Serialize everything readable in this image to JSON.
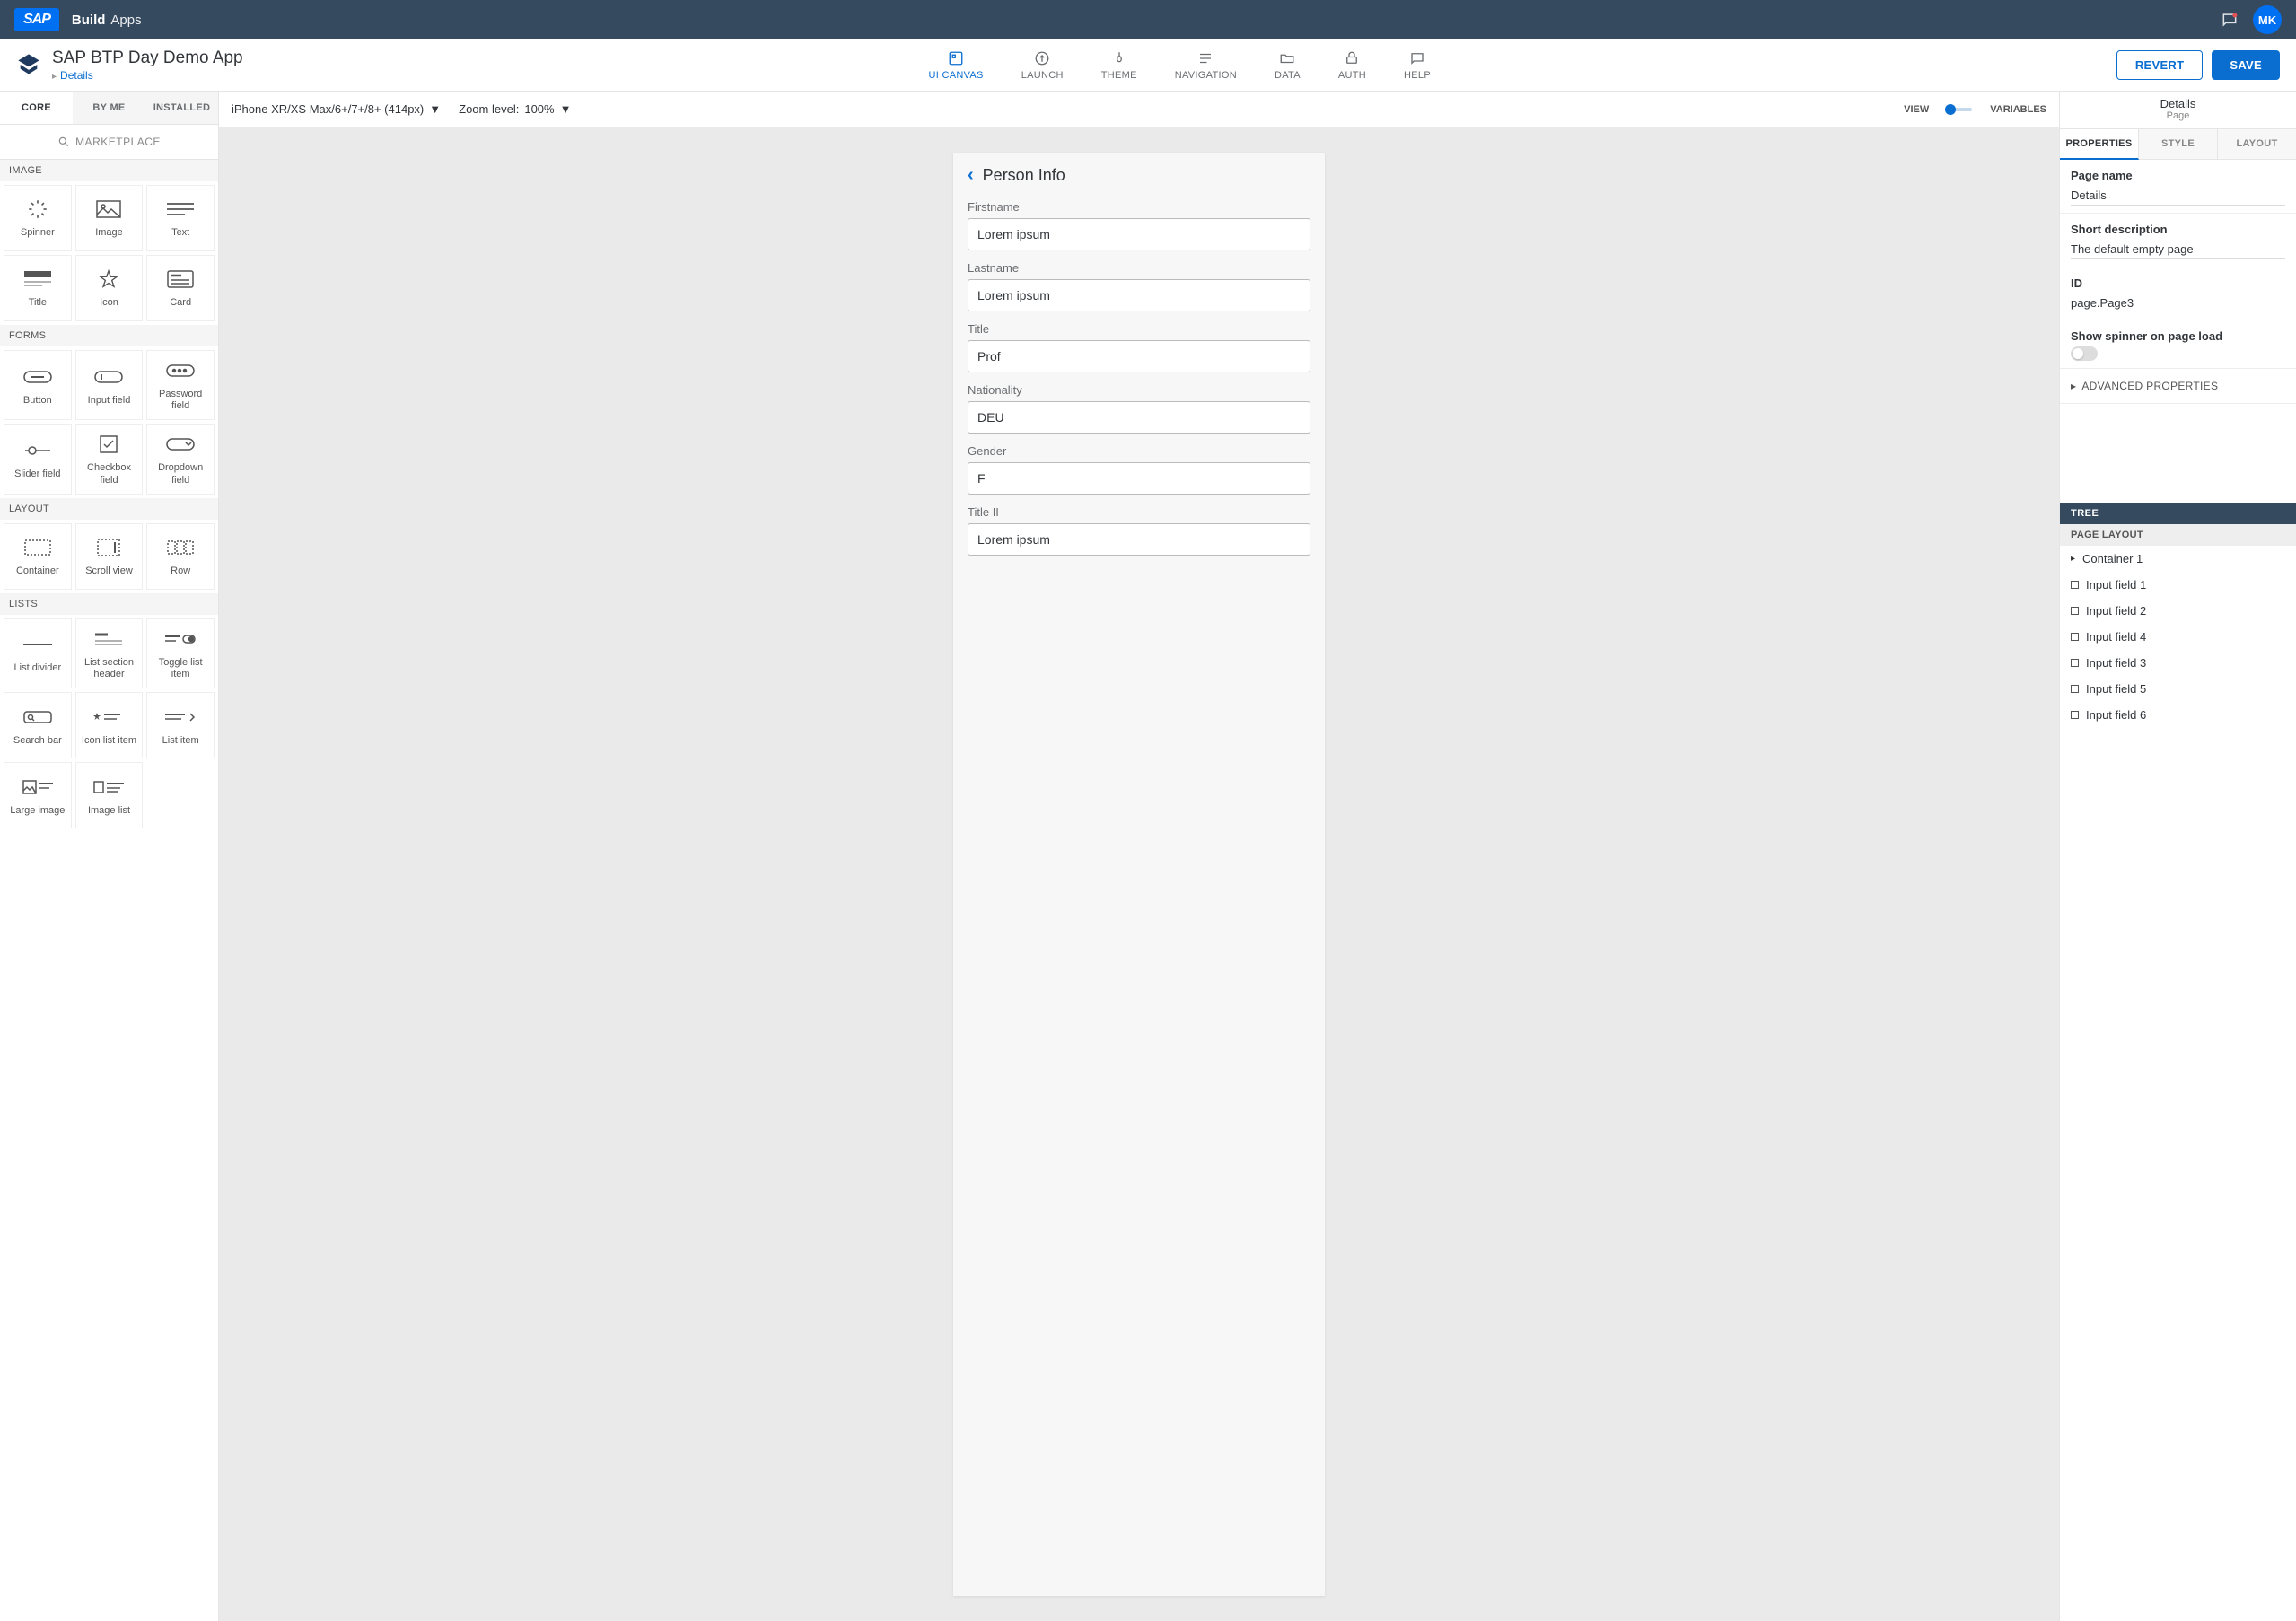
{
  "brand": {
    "logo": "SAP",
    "build": "Build",
    "apps": "Apps"
  },
  "avatar": "MK",
  "app": {
    "title": "SAP BTP Day Demo App",
    "breadcrumb": "Details"
  },
  "navTabs": [
    {
      "id": "ui-canvas",
      "label": "UI CANVAS",
      "active": true
    },
    {
      "id": "launch",
      "label": "LAUNCH"
    },
    {
      "id": "theme",
      "label": "THEME"
    },
    {
      "id": "navigation",
      "label": "NAVIGATION"
    },
    {
      "id": "data",
      "label": "DATA"
    },
    {
      "id": "auth",
      "label": "AUTH"
    },
    {
      "id": "help",
      "label": "HELP"
    }
  ],
  "buttons": {
    "revert": "REVERT",
    "save": "SAVE"
  },
  "libTabs": {
    "core": "CORE",
    "byMe": "BY ME",
    "installed": "INSTALLED"
  },
  "marketplace": "MARKETPLACE",
  "libSections": {
    "image": {
      "title": "IMAGE",
      "items": [
        "Spinner",
        "Image",
        "Text",
        "Title",
        "Icon",
        "Card"
      ]
    },
    "forms": {
      "title": "FORMS",
      "items": [
        "Button",
        "Input field",
        "Password field",
        "Slider field",
        "Checkbox field",
        "Dropdown field"
      ]
    },
    "layout": {
      "title": "LAYOUT",
      "items": [
        "Container",
        "Scroll view",
        "Row"
      ]
    },
    "lists": {
      "title": "LISTS",
      "items": [
        "List divider",
        "List section header",
        "Toggle list item",
        "Search bar",
        "Icon list item",
        "List item",
        "Large image",
        "Image list"
      ]
    }
  },
  "canvasToolbar": {
    "device": "iPhone XR/XS Max/6+/7+/8+ (414px)",
    "zoomLabel": "Zoom level:",
    "zoomValue": "100%",
    "viewLabel": "VIEW",
    "variablesLabel": "VARIABLES"
  },
  "deviceForm": {
    "title": "Person Info",
    "fields": [
      {
        "label": "Firstname",
        "value": "Lorem ipsum"
      },
      {
        "label": "Lastname",
        "value": "Lorem ipsum"
      },
      {
        "label": "Title",
        "value": "Prof"
      },
      {
        "label": "Nationality",
        "value": "DEU"
      },
      {
        "label": "Gender",
        "value": "F"
      },
      {
        "label": "Title II",
        "value": "Lorem ipsum"
      }
    ]
  },
  "pageInfo": {
    "title": "Details",
    "sub": "Page"
  },
  "propTabs": {
    "properties": "PROPERTIES",
    "style": "STYLE",
    "layout": "LAYOUT"
  },
  "props": {
    "pageName": {
      "label": "Page name",
      "value": "Details"
    },
    "shortDesc": {
      "label": "Short description",
      "value": "The default empty page"
    },
    "id": {
      "label": "ID",
      "value": "page.Page3"
    },
    "spinner": {
      "label": "Show spinner on page load"
    },
    "advanced": "ADVANCED PROPERTIES"
  },
  "tree": {
    "header": "TREE",
    "sub": "PAGE LAYOUT",
    "items": [
      {
        "label": "Container 1",
        "type": "expandable"
      },
      {
        "label": "Input field 1",
        "type": "leaf"
      },
      {
        "label": "Input field 2",
        "type": "leaf"
      },
      {
        "label": "Input field 4",
        "type": "leaf"
      },
      {
        "label": "Input field 3",
        "type": "leaf"
      },
      {
        "label": "Input field 5",
        "type": "leaf"
      },
      {
        "label": "Input field 6",
        "type": "leaf"
      }
    ]
  }
}
